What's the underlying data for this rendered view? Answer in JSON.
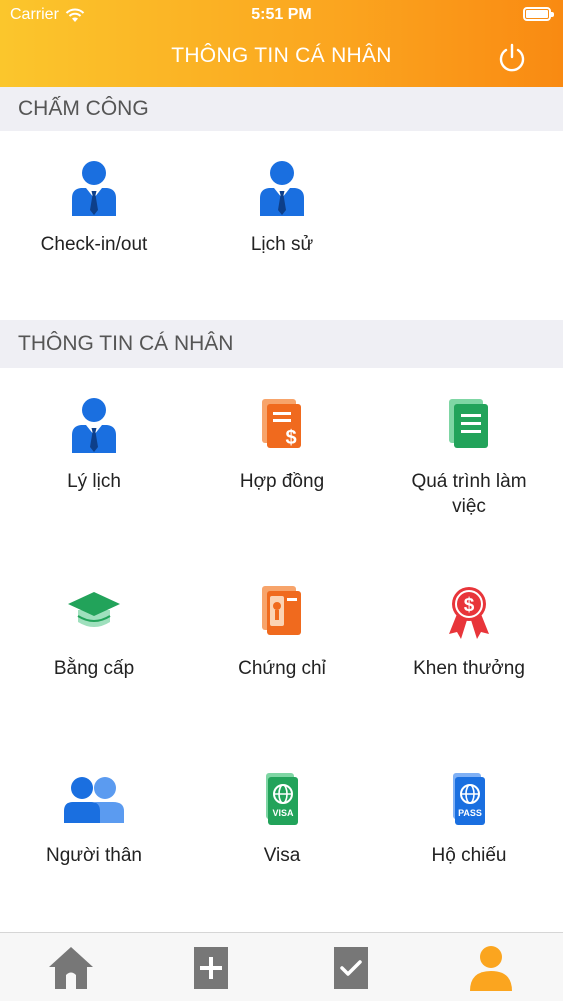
{
  "status_bar": {
    "carrier": "Carrier",
    "time": "5:51 PM"
  },
  "header": {
    "title": "THÔNG TIN CÁ NHÂN",
    "power_icon": "power-icon"
  },
  "sections": {
    "attendance": {
      "title": "CHẤM CÔNG",
      "items": [
        {
          "label": "Check-in/out",
          "icon": "user-tie-icon"
        },
        {
          "label": "Lịch sử",
          "icon": "user-tie-icon"
        }
      ]
    },
    "personal": {
      "title": "THÔNG TIN CÁ NHÂN",
      "items": [
        {
          "label": "Lý lịch",
          "icon": "user-tie-icon"
        },
        {
          "label": "Hợp đồng",
          "icon": "contract-icon"
        },
        {
          "label": "Quá trình làm việc",
          "icon": "document-stack-icon"
        },
        {
          "label": "Bằng cấp",
          "icon": "graduation-cap-icon"
        },
        {
          "label": "Chứng chỉ",
          "icon": "certificate-icon"
        },
        {
          "label": "Khen thưởng",
          "icon": "award-ribbon-icon"
        },
        {
          "label": "Người thân",
          "icon": "relatives-icon"
        },
        {
          "label": "Visa",
          "icon": "visa-icon"
        },
        {
          "label": "Hộ chiếu",
          "icon": "passport-icon"
        }
      ]
    }
  },
  "tabbar": {
    "tabs": [
      {
        "icon": "home-icon",
        "active": false
      },
      {
        "icon": "plus-icon",
        "active": false
      },
      {
        "icon": "checkmark-icon",
        "active": false
      },
      {
        "icon": "profile-icon",
        "active": true
      }
    ]
  },
  "colors": {
    "header_gradient_start": "#fbc62c",
    "header_gradient_end": "#f98a12",
    "icon_blue": "#1a6fe0",
    "icon_orange": "#f06a1e",
    "icon_green": "#22a35a",
    "icon_red": "#e8353a",
    "tab_active": "#fba51f",
    "tab_inactive": "#777777"
  },
  "labels": {
    "visa_badge": "VISA",
    "pass_badge": "PASS"
  }
}
